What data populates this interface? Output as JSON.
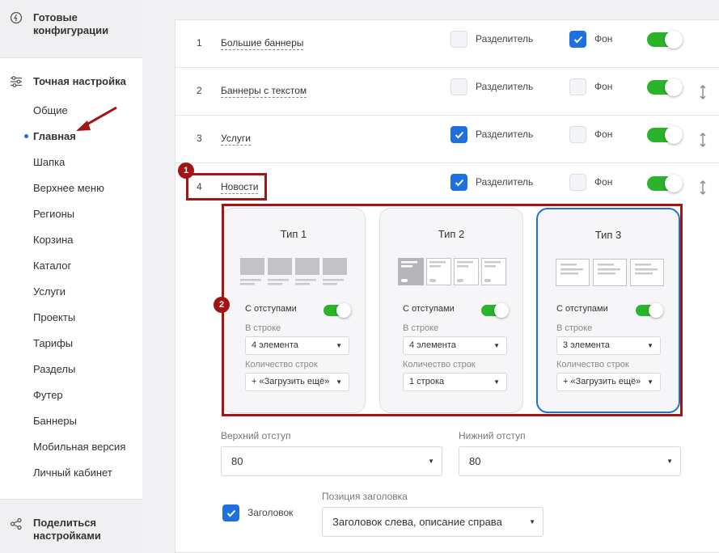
{
  "sidebar": {
    "top_heading": "Готовые\nконфигурации",
    "section_heading": "Точная настройка",
    "items": [
      "Общие",
      "Главная",
      "Шапка",
      "Верхнее меню",
      "Регионы",
      "Корзина",
      "Каталог",
      "Услуги",
      "Проекты",
      "Тарифы",
      "Разделы",
      "Футер",
      "Баннеры",
      "Мобильная версия",
      "Личный кабинет"
    ],
    "active_item": "Главная",
    "bottom_heading": "Поделиться\nнастройками"
  },
  "rows": [
    {
      "num": "1",
      "label": "Большие баннеры",
      "divider": false,
      "bg": true,
      "enabled": true
    },
    {
      "num": "2",
      "label": "Баннеры с текстом",
      "divider": false,
      "bg": false,
      "enabled": true
    },
    {
      "num": "3",
      "label": "Услуги",
      "divider": true,
      "bg": false,
      "enabled": true
    },
    {
      "num": "4",
      "label": "Новости",
      "divider": true,
      "bg": false,
      "enabled": true
    }
  ],
  "checkbox_labels": {
    "divider": "Разделитель",
    "bg": "Фон"
  },
  "markers": [
    "1",
    "2"
  ],
  "types": [
    {
      "title": "Тип 1",
      "margins_label": "С отступами",
      "per_row_label": "В строке",
      "per_row_value": "4 элемента",
      "rows_label": "Количество строк",
      "rows_value": "+ «Загрузить ещё»",
      "selected": false
    },
    {
      "title": "Тип 2",
      "margins_label": "С отступами",
      "per_row_label": "В строке",
      "per_row_value": "4 элемента",
      "rows_label": "Количество строк",
      "rows_value": "1 строка",
      "selected": false
    },
    {
      "title": "Тип 3",
      "margins_label": "С отступами",
      "per_row_label": "В строке",
      "per_row_value": "3 элемента",
      "rows_label": "Количество строк",
      "rows_value": "+ «Загрузить ещё»",
      "selected": true
    }
  ],
  "fields": {
    "top_padding_label": "Верхний отступ",
    "top_padding_value": "80",
    "bottom_padding_label": "Нижний отступ",
    "bottom_padding_value": "80",
    "heading_checkbox_label": "Заголовок",
    "heading_position_label": "Позиция заголовка",
    "heading_position_value": "Заголовок слева, описание справа"
  },
  "colors": {
    "accent": "#1e6fe0",
    "toggle_on": "#2bb32b",
    "annotation": "#a11515"
  }
}
